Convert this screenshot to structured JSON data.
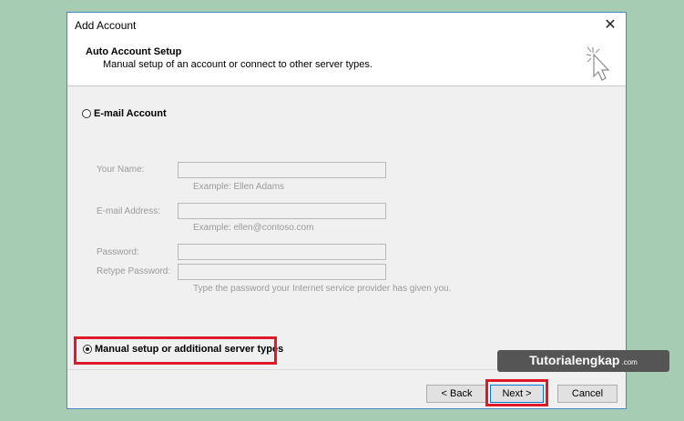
{
  "window": {
    "title": "Add Account",
    "close_symbol": "✕"
  },
  "header": {
    "title": "Auto Account Setup",
    "subtitle": "Manual setup of an account or connect to other server types.",
    "icon": "wizard-wand-icon"
  },
  "email_account": {
    "label": "E-mail Account",
    "selected": false,
    "fields": {
      "name_label": "Your Name:",
      "name_value": "",
      "name_hint": "Example: Ellen Adams",
      "email_label": "E-mail Address:",
      "email_value": "",
      "email_hint": "Example: ellen@contoso.com",
      "password_label": "Password:",
      "password_value": "",
      "retype_label": "Retype Password:",
      "retype_value": "",
      "password_hint": "Type the password your Internet service provider has given you."
    }
  },
  "manual_setup": {
    "label": "Manual setup or additional server types",
    "selected": true
  },
  "buttons": {
    "back": "< Back",
    "next": "Next >",
    "cancel": "Cancel"
  },
  "watermark": {
    "main": "Tutorialengkap",
    "tld": ".com"
  },
  "colors": {
    "background": "#a6cdb4",
    "highlight": "#e0182a",
    "dialog_border": "#4a86c8"
  }
}
